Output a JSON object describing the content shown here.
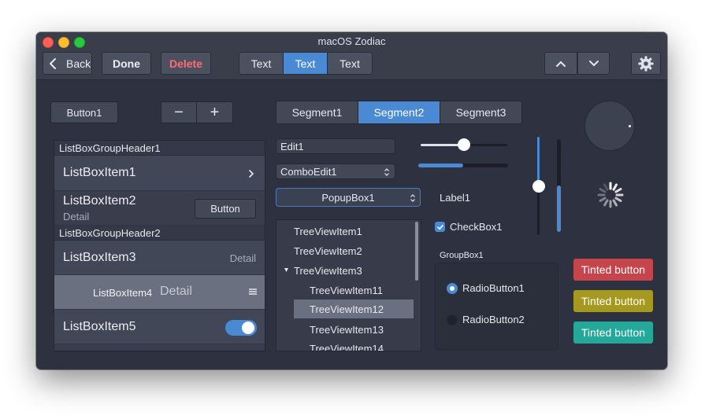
{
  "window": {
    "title": "macOS Zodiac"
  },
  "toolbar": {
    "back_label": "Back",
    "done_label": "Done",
    "delete_label": "Delete",
    "segments": [
      "Text",
      "Text",
      "Text"
    ],
    "selected_segment": 1
  },
  "controls": {
    "button1": "Button1",
    "stepper_minus": "−",
    "stepper_plus": "+",
    "segments": [
      "Segment1",
      "Segment2",
      "Segment3"
    ],
    "selected_segment": 1
  },
  "listbox": {
    "header1": "ListBoxGroupHeader1",
    "header2": "ListBoxGroupHeader2",
    "item1": "ListBoxItem1",
    "item2": "ListBoxItem2",
    "item2_detail": "Detail",
    "item2_button": "Button",
    "item3": "ListBoxItem3",
    "item3_detail": "Detail",
    "item4": "ListBoxItem4",
    "item4_detail": "Detail",
    "item5": "ListBoxItem5",
    "item5_toggle_on": true
  },
  "inputs": {
    "edit1": "Edit1",
    "comboedit1": "ComboEdit1",
    "popupbox1": "PopupBox1",
    "label1": "Label1",
    "checkbox1": "CheckBox1",
    "checkbox1_checked": true
  },
  "sliders": {
    "h_slider_value": 0.5,
    "h_progress_value": 0.5,
    "v_slider_value": 0.5,
    "v_progress_value": 0.5
  },
  "tree": {
    "items": [
      {
        "label": "TreeViewItem1",
        "level": 0
      },
      {
        "label": "TreeViewItem2",
        "level": 0
      },
      {
        "label": "TreeViewItem3",
        "level": 0,
        "expanded": true
      },
      {
        "label": "TreeViewItem11",
        "level": 1
      },
      {
        "label": "TreeViewItem12",
        "level": 1,
        "selected": true
      },
      {
        "label": "TreeViewItem13",
        "level": 1
      },
      {
        "label": "TreeViewItem14",
        "level": 1
      }
    ]
  },
  "groupbox": {
    "title": "GroupBox1",
    "radio1": "RadioButton1",
    "radio2": "RadioButton2",
    "selected_radio": 1
  },
  "tinted_buttons": [
    {
      "label": "Tinted button",
      "color": "#c5454c"
    },
    {
      "label": "Tinted button",
      "color": "#a59a1f"
    },
    {
      "label": "Tinted button",
      "color": "#23a899"
    }
  ],
  "colors": {
    "accent": "#4a8ad4",
    "delete_text": "#ff6b72",
    "window_bg": "#2e3240"
  }
}
